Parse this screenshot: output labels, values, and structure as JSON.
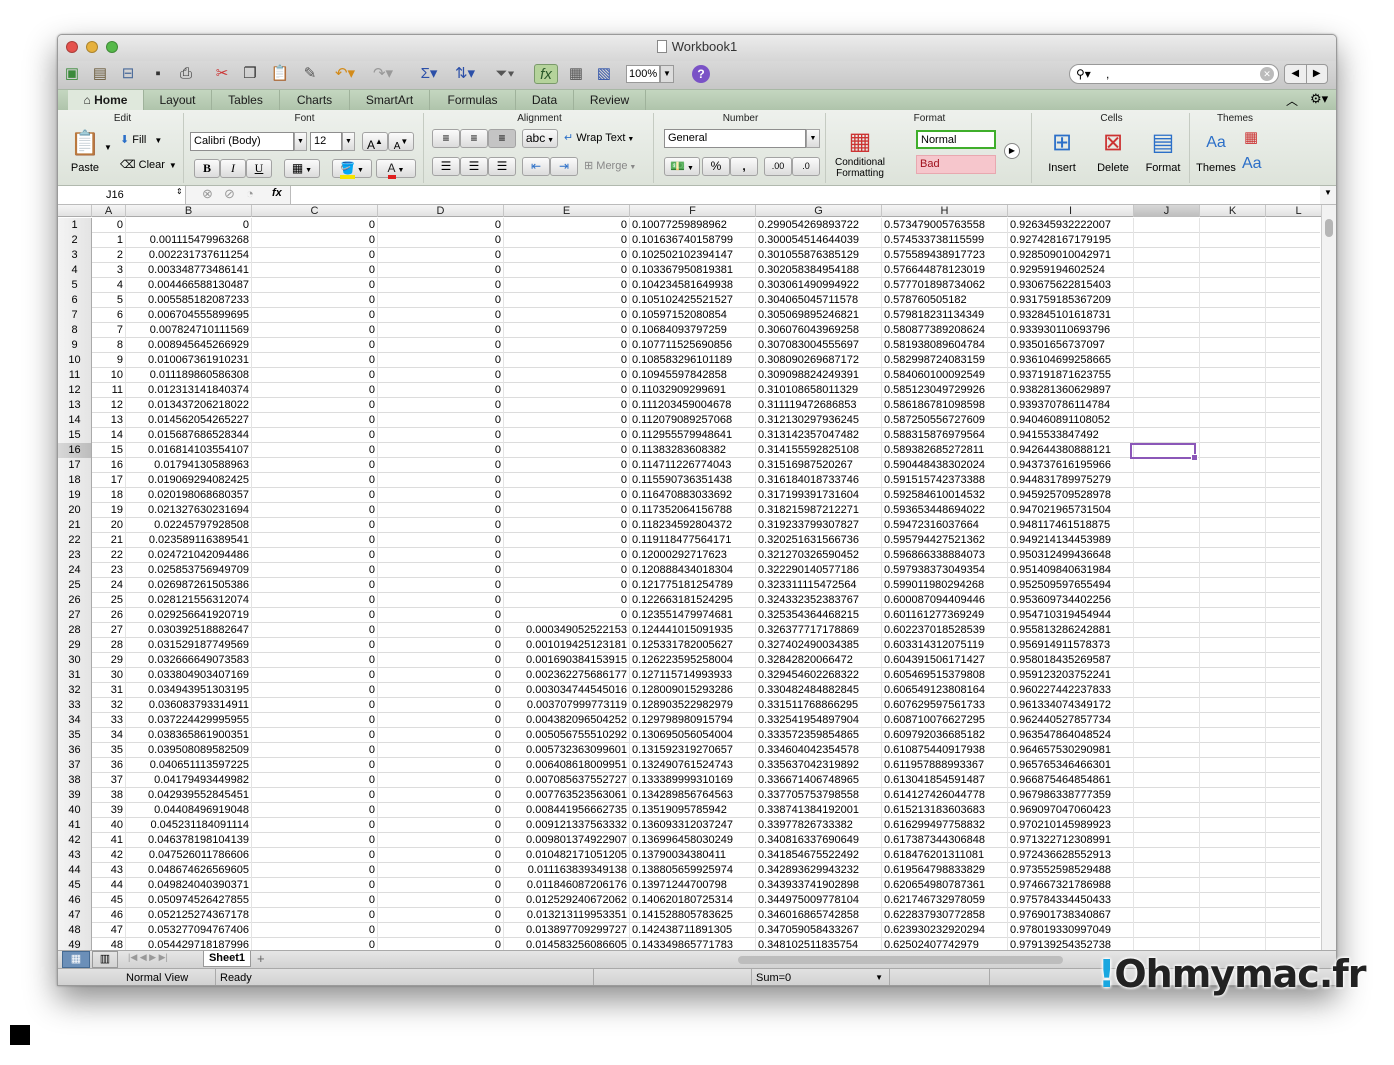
{
  "window": {
    "title": "Workbook1",
    "close_color": "#e5524d",
    "min_color": "#e6b13d",
    "max_color": "#56b94a"
  },
  "toolbar": {
    "icons": [
      "new-icon",
      "templates-icon",
      "open-icon",
      "save-icon",
      "print-icon",
      "cut-icon",
      "copy-icon",
      "paste-icon",
      "format-painter-icon",
      "undo-icon",
      "redo-icon",
      "autosum-icon",
      "sort-icon",
      "filter-icon",
      "formula-builder-icon",
      "show-sheet-icon",
      "media-browser-icon"
    ],
    "zoom": "100%",
    "help": "?",
    "search_value": ","
  },
  "tabs": [
    "Home",
    "Layout",
    "Tables",
    "Charts",
    "SmartArt",
    "Formulas",
    "Data",
    "Review"
  ],
  "active_tab": "Home",
  "ribbon": {
    "edit": {
      "title": "Edit",
      "paste": "Paste",
      "fill": "Fill",
      "clear": "Clear"
    },
    "font": {
      "title": "Font",
      "name": "Calibri (Body)",
      "size": "12",
      "bold": "B",
      "italic": "I",
      "underline": "U",
      "grow": "A",
      "shrink": "A",
      "color_letter": "A",
      "highlight_color": "#f5e400",
      "font_color": "#e02020"
    },
    "alignment": {
      "title": "Alignment",
      "orientation": "abc",
      "wrap": "Wrap Text",
      "merge": "Merge"
    },
    "number": {
      "title": "Number",
      "format": "General",
      "percent": "%",
      "comma": ",",
      "inc": ".00",
      "dec": ".0"
    },
    "format": {
      "title": "Format",
      "conditional": "Conditional Formatting",
      "normal": "Normal",
      "bad": "Bad",
      "normal_border": "#3fae2b",
      "bad_bg": "#f6c6cc",
      "bad_text": "#a0111d"
    },
    "cells": {
      "title": "Cells",
      "insert": "Insert",
      "delete": "Delete",
      "format": "Format"
    },
    "themes": {
      "title": "Themes",
      "themes": "Themes",
      "sample": "Aa"
    }
  },
  "formula_bar": {
    "name_box": "J16",
    "fx": "fx",
    "formula": ""
  },
  "grid": {
    "columns": [
      "A",
      "B",
      "C",
      "D",
      "E",
      "F",
      "G",
      "H",
      "I",
      "J",
      "K",
      "L"
    ],
    "selected_column": "J",
    "selected_row": 16,
    "rows": [
      {
        "n": 1,
        "cells": [
          "0",
          "0",
          "0",
          "0",
          "0",
          "0.10077259898962",
          "0.299054269893722",
          "0.573479005763558",
          "0.926345932222007"
        ]
      },
      {
        "n": 2,
        "cells": [
          "1",
          "0.001115479963268",
          "0",
          "0",
          "0",
          "0.101636740158799",
          "0.300054514644039",
          "0.574533738115599",
          "0.927428167179195"
        ]
      },
      {
        "n": 3,
        "cells": [
          "2",
          "0.002231737611254",
          "0",
          "0",
          "0",
          "0.102502102394147",
          "0.301055876385129",
          "0.575589438917723",
          "0.928509010042971"
        ]
      },
      {
        "n": 4,
        "cells": [
          "3",
          "0.003348773486141",
          "0",
          "0",
          "0",
          "0.103367950819381",
          "0.302058384954188",
          "0.576644878123019",
          "0.92959194602524"
        ]
      },
      {
        "n": 5,
        "cells": [
          "4",
          "0.004466588130487",
          "0",
          "0",
          "0",
          "0.104234581649938",
          "0.303061490994922",
          "0.577701898734062",
          "0.930675622815403"
        ]
      },
      {
        "n": 6,
        "cells": [
          "5",
          "0.005585182087233",
          "0",
          "0",
          "0",
          "0.105102425521527",
          "0.304065045711578",
          "0.578760505182",
          "0.931759185367209"
        ]
      },
      {
        "n": 7,
        "cells": [
          "6",
          "0.006704555899695",
          "0",
          "0",
          "0",
          "0.10597152080854",
          "0.305069895246821",
          "0.579818231134349",
          "0.932845101618731"
        ]
      },
      {
        "n": 8,
        "cells": [
          "7",
          "0.007824710111569",
          "0",
          "0",
          "0",
          "0.10684093797259",
          "0.306076043969258",
          "0.580877389208624",
          "0.933930110693796"
        ]
      },
      {
        "n": 9,
        "cells": [
          "8",
          "0.008945645266929",
          "0",
          "0",
          "0",
          "0.107711525690856",
          "0.307083004555697",
          "0.581938089604784",
          "0.93501656737097"
        ]
      },
      {
        "n": 10,
        "cells": [
          "9",
          "0.010067361910231",
          "0",
          "0",
          "0",
          "0.108583296101189",
          "0.308090269687172",
          "0.582998724083159",
          "0.936104699258665"
        ]
      },
      {
        "n": 11,
        "cells": [
          "10",
          "0.011189860586308",
          "0",
          "0",
          "0",
          "0.10945597842858",
          "0.309098824249391",
          "0.584060100092549",
          "0.937191871623755"
        ]
      },
      {
        "n": 12,
        "cells": [
          "11",
          "0.012313141840374",
          "0",
          "0",
          "0",
          "0.11032909299691",
          "0.310108658011329",
          "0.585123049729926",
          "0.938281360629897"
        ]
      },
      {
        "n": 13,
        "cells": [
          "12",
          "0.013437206218022",
          "0",
          "0",
          "0",
          "0.111203459004678",
          "0.311119472686853",
          "0.586186781098598",
          "0.939370786114784"
        ]
      },
      {
        "n": 14,
        "cells": [
          "13",
          "0.014562054265227",
          "0",
          "0",
          "0",
          "0.112079089257068",
          "0.312130297936245",
          "0.587250556727609",
          "0.940460891108052"
        ]
      },
      {
        "n": 15,
        "cells": [
          "14",
          "0.015687686528344",
          "0",
          "0",
          "0",
          "0.112955579948641",
          "0.313142357047482",
          "0.588315876979564",
          "0.9415533847492"
        ]
      },
      {
        "n": 16,
        "cells": [
          "15",
          "0.016814103554107",
          "0",
          "0",
          "0",
          "0.11383283608382",
          "0.314155592825108",
          "0.589382685272811",
          "0.942644380888121"
        ]
      },
      {
        "n": 17,
        "cells": [
          "16",
          "0.01794130588963",
          "0",
          "0",
          "0",
          "0.114711226774043",
          "0.31516987520267",
          "0.590448438302024",
          "0.943737616195966"
        ]
      },
      {
        "n": 18,
        "cells": [
          "17",
          "0.019069294082425",
          "0",
          "0",
          "0",
          "0.115590736351438",
          "0.316184018733746",
          "0.591515742373388",
          "0.944831789975279"
        ]
      },
      {
        "n": 19,
        "cells": [
          "18",
          "0.020198068680357",
          "0",
          "0",
          "0",
          "0.116470883033692",
          "0.317199391731604",
          "0.592584610014532",
          "0.945925709528978"
        ]
      },
      {
        "n": 20,
        "cells": [
          "19",
          "0.021327630231694",
          "0",
          "0",
          "0",
          "0.117352064156788",
          "0.318215987212271",
          "0.593653448694022",
          "0.947021965731504"
        ]
      },
      {
        "n": 21,
        "cells": [
          "20",
          "0.02245797928508",
          "0",
          "0",
          "0",
          "0.118234592804372",
          "0.319233799307827",
          "0.59472316037664",
          "0.948117461518875"
        ]
      },
      {
        "n": 22,
        "cells": [
          "21",
          "0.023589116389541",
          "0",
          "0",
          "0",
          "0.119118477564171",
          "0.320251631566736",
          "0.595794427521362",
          "0.949214134453989"
        ]
      },
      {
        "n": 23,
        "cells": [
          "22",
          "0.024721042094486",
          "0",
          "0",
          "0",
          "0.12000292717623",
          "0.321270326590452",
          "0.596866338884073",
          "0.950312499436648"
        ]
      },
      {
        "n": 24,
        "cells": [
          "23",
          "0.025853756949709",
          "0",
          "0",
          "0",
          "0.120888434018304",
          "0.322290140577186",
          "0.597938373049354",
          "0.951409840631984"
        ]
      },
      {
        "n": 25,
        "cells": [
          "24",
          "0.026987261505386",
          "0",
          "0",
          "0",
          "0.121775181254789",
          "0.323311115472564",
          "0.599011980294268",
          "0.952509597655494"
        ]
      },
      {
        "n": 26,
        "cells": [
          "25",
          "0.028121556312074",
          "0",
          "0",
          "0",
          "0.122663181524295",
          "0.324332352383767",
          "0.600087094409446",
          "0.953609734402256"
        ]
      },
      {
        "n": 27,
        "cells": [
          "26",
          "0.029256641920719",
          "0",
          "0",
          "0",
          "0.123551479974681",
          "0.325354364468215",
          "0.601161277369249",
          "0.954710319454944"
        ]
      },
      {
        "n": 28,
        "cells": [
          "27",
          "0.030392518882647",
          "0",
          "0",
          "0.000349052522153",
          "0.124441015091935",
          "0.326377717178869",
          "0.602237018528539",
          "0.955813286242881"
        ]
      },
      {
        "n": 29,
        "cells": [
          "28",
          "0.031529187749569",
          "0",
          "0",
          "0.001019425123181",
          "0.125331782005627",
          "0.327402490034385",
          "0.603314312075119",
          "0.956914911578373"
        ]
      },
      {
        "n": 30,
        "cells": [
          "29",
          "0.032666649073583",
          "0",
          "0",
          "0.001690384153915",
          "0.126223595258004",
          "0.32842820066472",
          "0.604391506171427",
          "0.958018435269587"
        ]
      },
      {
        "n": 31,
        "cells": [
          "30",
          "0.033804903407169",
          "0",
          "0",
          "0.002362275686177",
          "0.127115714993933",
          "0.329454602268322",
          "0.605469515379808",
          "0.959123203752241"
        ]
      },
      {
        "n": 32,
        "cells": [
          "31",
          "0.034943951303195",
          "0",
          "0",
          "0.003034744545016",
          "0.128009015293286",
          "0.330482484882845",
          "0.606549123808164",
          "0.960227442237833"
        ]
      },
      {
        "n": 33,
        "cells": [
          "32",
          "0.036083793314911",
          "0",
          "0",
          "0.003707999773119",
          "0.128903522982979",
          "0.331511768866295",
          "0.607629597561733",
          "0.961334074349172"
        ]
      },
      {
        "n": 34,
        "cells": [
          "33",
          "0.037224429995955",
          "0",
          "0",
          "0.004382096504252",
          "0.129798980915794",
          "0.332541954897904",
          "0.608710076627295",
          "0.962440527857734"
        ]
      },
      {
        "n": 35,
        "cells": [
          "34",
          "0.038365861900351",
          "0",
          "0",
          "0.005056755510292",
          "0.130695056054004",
          "0.333572359854865",
          "0.609792036685182",
          "0.963547864048524"
        ]
      },
      {
        "n": 36,
        "cells": [
          "35",
          "0.039508089582509",
          "0",
          "0",
          "0.005732363099601",
          "0.131592319270657",
          "0.334604042354578",
          "0.610875440917938",
          "0.964657530290981"
        ]
      },
      {
        "n": 37,
        "cells": [
          "36",
          "0.040651113597225",
          "0",
          "0",
          "0.006408618009951",
          "0.132490761524743",
          "0.335637042319892",
          "0.611957888993367",
          "0.965765346466301"
        ]
      },
      {
        "n": 38,
        "cells": [
          "37",
          "0.04179493449982",
          "0",
          "0",
          "0.007085637552727",
          "0.133389999310169",
          "0.336671406748965",
          "0.613041854591487",
          "0.966875464854861"
        ]
      },
      {
        "n": 39,
        "cells": [
          "38",
          "0.042939552845451",
          "0",
          "0",
          "0.007763523563061",
          "0.134289856764563",
          "0.337705753798558",
          "0.614127426044778",
          "0.967986338777359"
        ]
      },
      {
        "n": 40,
        "cells": [
          "39",
          "0.04408496919048",
          "0",
          "0",
          "0.008441956662735",
          "0.13519095785942",
          "0.338741384192001",
          "0.615213183603683",
          "0.969097047060423"
        ]
      },
      {
        "n": 41,
        "cells": [
          "40",
          "0.045231184091114",
          "0",
          "0",
          "0.009121337563332",
          "0.136093312037247",
          "0.33977826733382",
          "0.616299497758832",
          "0.970210145989923"
        ]
      },
      {
        "n": 42,
        "cells": [
          "41",
          "0.046378198104139",
          "0",
          "0",
          "0.009801374922907",
          "0.136996458030249",
          "0.340816337690649",
          "0.617387344306848",
          "0.971322712308991"
        ]
      },
      {
        "n": 43,
        "cells": [
          "42",
          "0.047526011786606",
          "0",
          "0",
          "0.010482171051205",
          "0.13790034380411",
          "0.341854675522492",
          "0.618476201311081",
          "0.972436628552913"
        ]
      },
      {
        "n": 44,
        "cells": [
          "43",
          "0.048674626569605",
          "0",
          "0",
          "0.011163839349138",
          "0.138805659925974",
          "0.342893629943232",
          "0.619564798833829",
          "0.973552598529488"
        ]
      },
      {
        "n": 45,
        "cells": [
          "44",
          "0.049824040390371",
          "0",
          "0",
          "0.011846087206176",
          "0.13971244700798",
          "0.343933741902898",
          "0.620654980787361",
          "0.974667321786988"
        ]
      },
      {
        "n": 46,
        "cells": [
          "45",
          "0.050974526427855",
          "0",
          "0",
          "0.012529240672062",
          "0.140620180725314",
          "0.344975009778104",
          "0.621746732978059",
          "0.975784334450433"
        ]
      },
      {
        "n": 47,
        "cells": [
          "46",
          "0.052125274367178",
          "0",
          "0",
          "0.013213119953351",
          "0.141528805783625",
          "0.346016865742858",
          "0.622837930772858",
          "0.976901738340867"
        ]
      },
      {
        "n": 48,
        "cells": [
          "47",
          "0.053277094767406",
          "0",
          "0",
          "0.013897709299727",
          "0.142438711891305",
          "0.347059058433267",
          "0.623930232920294",
          "0.978019330997049"
        ]
      },
      {
        "n": 49,
        "cells": [
          "48",
          "0.054429718187996",
          "0",
          "0",
          "0.014583256086605",
          "0.143349865771783",
          "0.348102511835754",
          "0.62502407742979",
          "0.979139254352738"
        ]
      }
    ]
  },
  "sheets": [
    "Sheet1"
  ],
  "status": {
    "view": "Normal View",
    "state": "Ready",
    "sum": "Sum=0"
  },
  "watermark": {
    "bang": "!",
    "text": "Ohmymac.fr"
  }
}
